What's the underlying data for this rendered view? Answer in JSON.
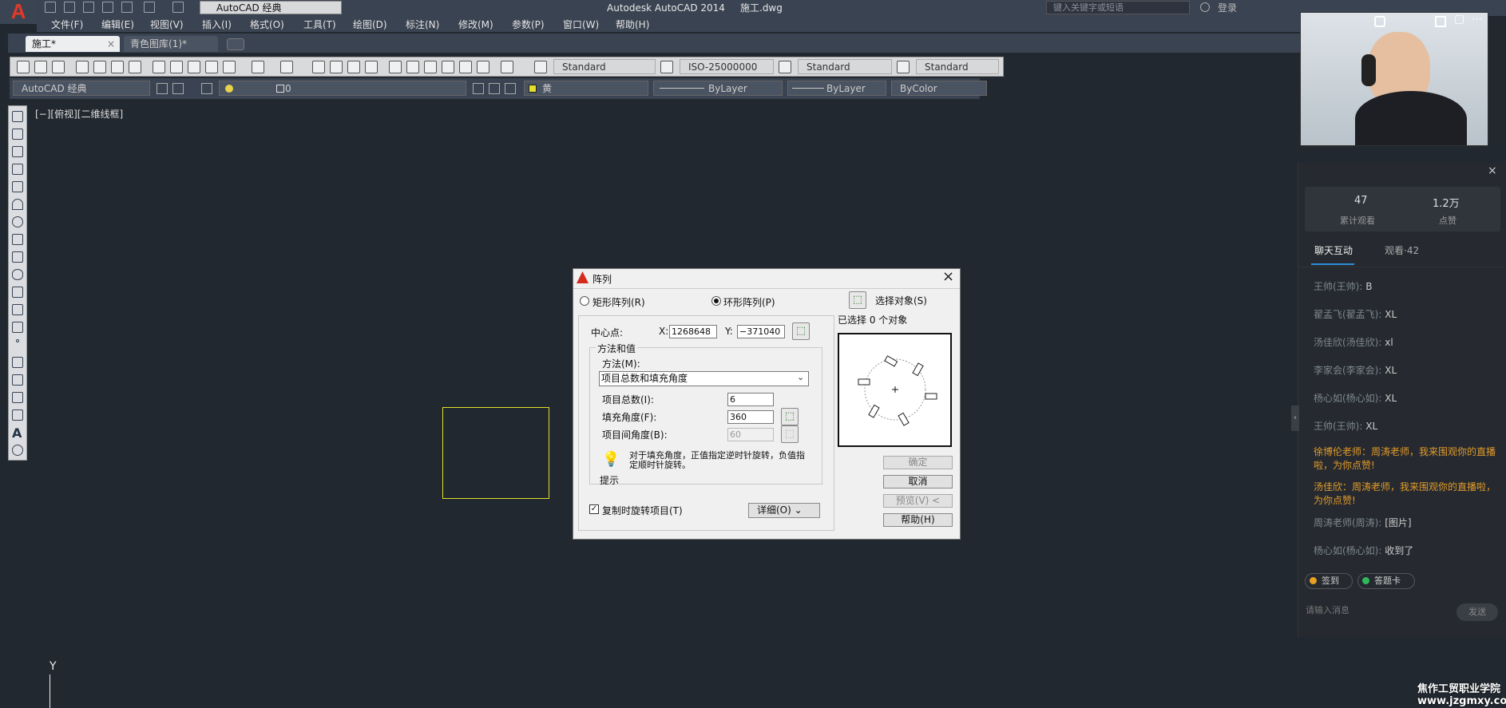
{
  "app": {
    "title": "Autodesk AutoCAD 2014",
    "file": "施工.dwg",
    "workspace": "AutoCAD 经典",
    "search_placeholder": "键入关键字或短语",
    "login": "登录"
  },
  "menu": [
    "文件(F)",
    "编辑(E)",
    "视图(V)",
    "插入(I)",
    "格式(O)",
    "工具(T)",
    "绘图(D)",
    "标注(N)",
    "修改(M)",
    "参数(P)",
    "窗口(W)",
    "帮助(H)"
  ],
  "tabs": [
    {
      "label": "施工*",
      "close": "×"
    },
    {
      "label": "青色图库(1)*"
    }
  ],
  "styles": {
    "text": "Standard",
    "dim": "ISO-25000000",
    "table": "Standard",
    "mleader": "Standard"
  },
  "layer": {
    "workspace": "AutoCAD 经典",
    "name": "0",
    "color": "黄",
    "linetype": "ByLayer",
    "lineweight": "ByLayer",
    "plotstyle": "ByColor"
  },
  "viewport_label": "[−][俯视][二维线框]",
  "ucs": {
    "y_label": "Y"
  },
  "dialog": {
    "title": "阵列",
    "rect_option": "矩形阵列(R)",
    "polar_option": "环形阵列(P)",
    "select_objects": "选择对象(S)",
    "selected_count": "已选择 0 个对象",
    "center_label": "中心点:",
    "x_label": "X:",
    "x_value": "1268648",
    "y_label": "Y:",
    "y_value": "−371040",
    "method_group": "方法和值",
    "method_label": "方法(M):",
    "method_value": "项目总数和填充角度",
    "total_label": "项目总数(I):",
    "total_value": "6",
    "fill_label": "填充角度(F):",
    "fill_value": "360",
    "between_label": "项目间角度(B):",
    "between_value": "60",
    "hint_text": "对于填充角度，正值指定逆时针旋转，负值指定顺时针旋转。",
    "hint_label": "提示",
    "rotate_label": "复制时旋转项目(T)",
    "detail_btn": "详细(O)",
    "ok": "确定",
    "cancel": "取消",
    "preview": "预览(V) <",
    "help": "帮助(H)"
  },
  "live": {
    "views": "47",
    "views_label": "累计观看",
    "likes": "1.2万",
    "likes_label": "点赞",
    "tab_chat": "聊天互动",
    "tab_viewers": "观看·42",
    "messages": [
      {
        "name": "王帅(王帅):",
        "text": "B"
      },
      {
        "name": "翟孟飞(翟孟飞):",
        "text": "XL"
      },
      {
        "name": "汤佳欣(汤佳欣):",
        "text": "xl"
      },
      {
        "name": "李家会(李家会):",
        "text": "XL"
      },
      {
        "name": "杨心如(杨心如):",
        "text": "XL"
      },
      {
        "name": "王帅(王帅):",
        "text": "XL"
      },
      {
        "name": "",
        "text": "徐博伦老师：周涛老师，我来围观你的直播啦，为你点赞!"
      },
      {
        "name": "",
        "text": "汤佳欣：周涛老师，我来围观你的直播啦，为你点赞!"
      },
      {
        "name": "周涛老师(周涛):",
        "text": "[图片]"
      },
      {
        "name": "杨心如(杨心如):",
        "text": "收到了"
      }
    ],
    "signin": "签到",
    "answer_card": "答题卡",
    "input_placeholder": "请输入消息",
    "send": "发送"
  },
  "watermark": "焦作工贸职业学院 www.jzgmxy.com",
  "colors": {
    "canvas": "#212830",
    "accent": "#2f8cd8",
    "orange": "#e19a2a",
    "yellow": "#e3e02b"
  }
}
